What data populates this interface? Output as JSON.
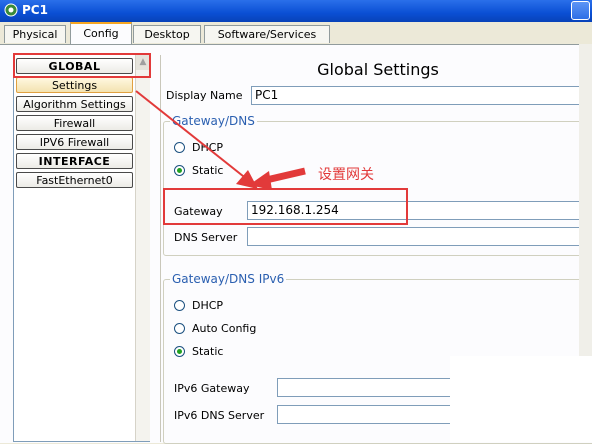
{
  "window": {
    "title": "PC1"
  },
  "tabs": [
    "Physical",
    "Config",
    "Desktop",
    "Software/Services"
  ],
  "sidebar": {
    "items": [
      {
        "label": "GLOBAL"
      },
      {
        "label": "Settings"
      },
      {
        "label": "Algorithm Settings"
      },
      {
        "label": "Firewall"
      },
      {
        "label": "IPV6 Firewall"
      },
      {
        "label": "INTERFACE"
      },
      {
        "label": "FastEthernet0"
      }
    ]
  },
  "main": {
    "title": "Global Settings",
    "display_name_label": "Display Name",
    "display_name_value": "PC1",
    "gateway_dns": {
      "group_title": "Gateway/DNS",
      "dhcp_label": "DHCP",
      "static_label": "Static",
      "selected": "Static",
      "gateway_label": "Gateway",
      "gateway_value": "192.168.1.254",
      "dns_server_label": "DNS Server",
      "dns_server_value": ""
    },
    "gateway_dns_ipv6": {
      "group_title": "Gateway/DNS IPv6",
      "dhcp_label": "DHCP",
      "auto_config_label": "Auto Config",
      "static_label": "Static",
      "selected": "Static",
      "ipv6_gateway_label": "IPv6 Gateway",
      "ipv6_gateway_value": "",
      "ipv6_dns_label": "IPv6 DNS Server",
      "ipv6_dns_value": ""
    }
  },
  "annotation": {
    "text": "设置网关",
    "color": "#e23a3a"
  }
}
